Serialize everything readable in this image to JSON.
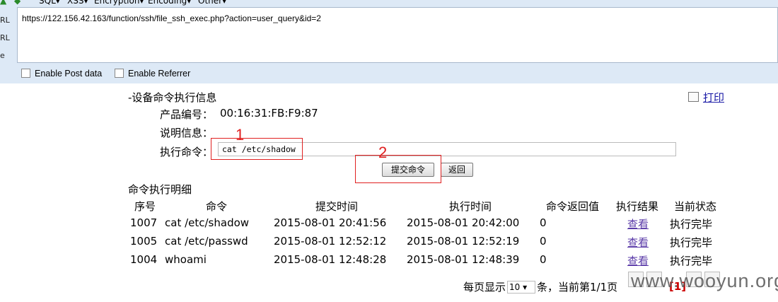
{
  "hackbar": {
    "menus": [
      "SQL▾",
      "XSS▾",
      "Encryption▾",
      "Encoding▾",
      "Other▾"
    ],
    "side_labels": [
      "RL",
      "RL",
      "e"
    ],
    "url": "https://122.156.42.163/function/ssh/file_ssh_exec.php?action=user_query&id=2",
    "enable_post": "Enable Post data",
    "enable_referrer": "Enable Referrer"
  },
  "page": {
    "section_title": "-设备命令执行信息",
    "print_label": "打印",
    "product_label": "产品编号：",
    "product_value": "00:16:31:FB:F9:87",
    "desc_label": "说明信息：",
    "cmd_label": "执行命令：",
    "cmd_value": "cat /etc/shadow",
    "submit_label": "提交命令",
    "back_label": "返回",
    "annotation_1": "1",
    "annotation_2": "2",
    "detail_title": "命令执行明细"
  },
  "table": {
    "headers": [
      "序号",
      "命令",
      "提交时间",
      "执行时间",
      "命令返回值",
      "执行结果",
      "当前状态"
    ],
    "rows": [
      {
        "id": "1007",
        "cmd": "cat /etc/shadow",
        "submit": "2015-08-01 20:41:56",
        "exec": "2015-08-01 20:42:00",
        "ret": "0",
        "result": "查看",
        "status": "执行完毕"
      },
      {
        "id": "1005",
        "cmd": "cat /etc/passwd",
        "submit": "2015-08-01 12:52:12",
        "exec": "2015-08-01 12:52:19",
        "ret": "0",
        "result": "查看",
        "status": "执行完毕"
      },
      {
        "id": "1004",
        "cmd": "whoami",
        "submit": "2015-08-01 12:48:28",
        "exec": "2015-08-01 12:48:39",
        "ret": "0",
        "result": "查看",
        "status": "执行完毕"
      }
    ]
  },
  "pager": {
    "prefix": "每页显示",
    "page_size": "10",
    "suffix": "条，当前第1/1页",
    "current": "[1]"
  },
  "watermark": "www.wooyun.org"
}
